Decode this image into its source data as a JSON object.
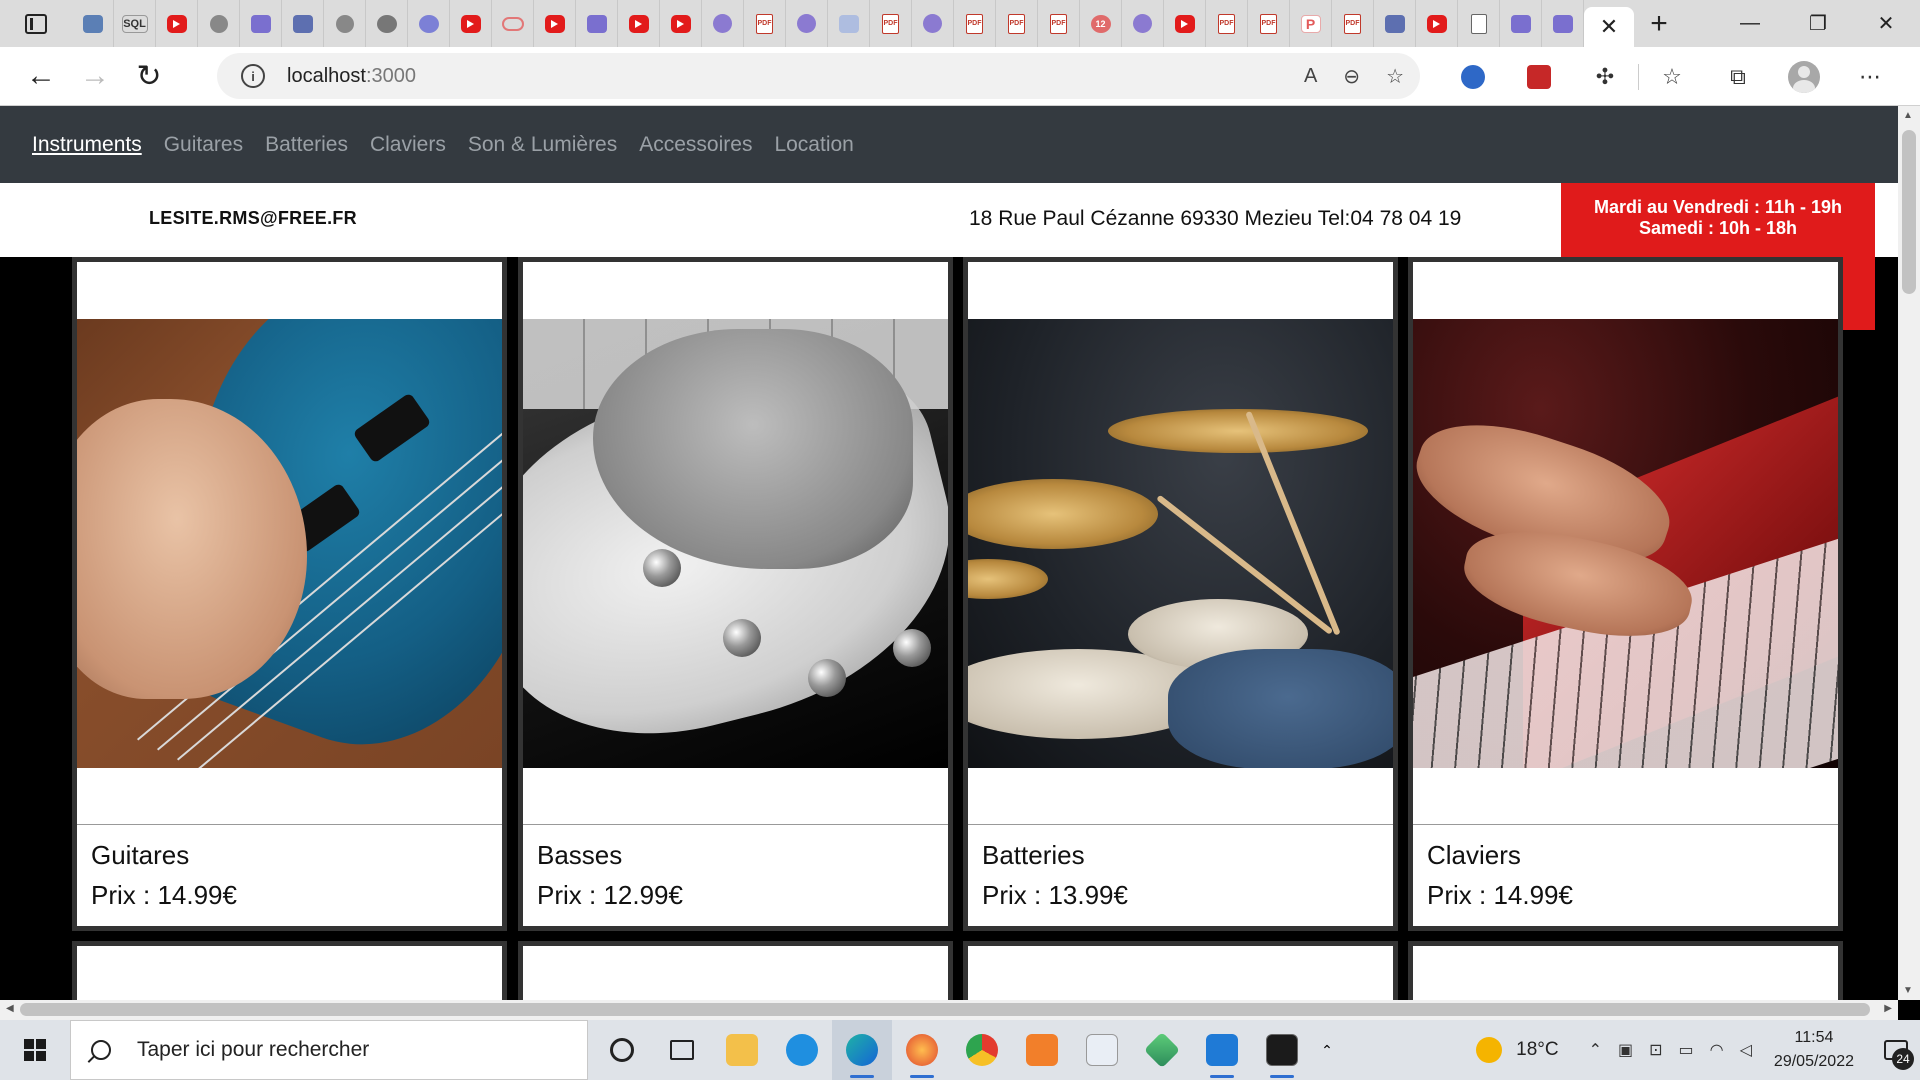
{
  "browser": {
    "url_host": "localhost",
    "url_port": ":3000",
    "active_tab_close": "✕",
    "new_tab": "+"
  },
  "site": {
    "nav": [
      "Instruments",
      "Guitares",
      "Batteries",
      "Claviers",
      "Son & Lumières",
      "Accessoires",
      "Location"
    ],
    "email": "LESITE.RMS@FREE.FR",
    "address": "18 Rue Paul Cézanne 69330 Mezieu Tel:04 78 04 19",
    "hours_line1": "Mardi au Vendredi : 11h - 19h",
    "hours_line2": "Samedi : 10h - 18h",
    "products": [
      {
        "name": "Guitares",
        "price": "Prix : 14.99€"
      },
      {
        "name": "Basses",
        "price": "Prix : 12.99€"
      },
      {
        "name": "Batteries",
        "price": "Prix : 13.99€"
      },
      {
        "name": "Claviers",
        "price": "Prix : 14.99€"
      }
    ]
  },
  "taskbar": {
    "search_placeholder": "Taper ici pour rechercher",
    "temperature": "18°C",
    "time": "11:54",
    "date": "29/05/2022",
    "notif_count": "24"
  },
  "colors": {
    "accent_red": "#e01b1b",
    "nav_bg": "#343a40"
  }
}
